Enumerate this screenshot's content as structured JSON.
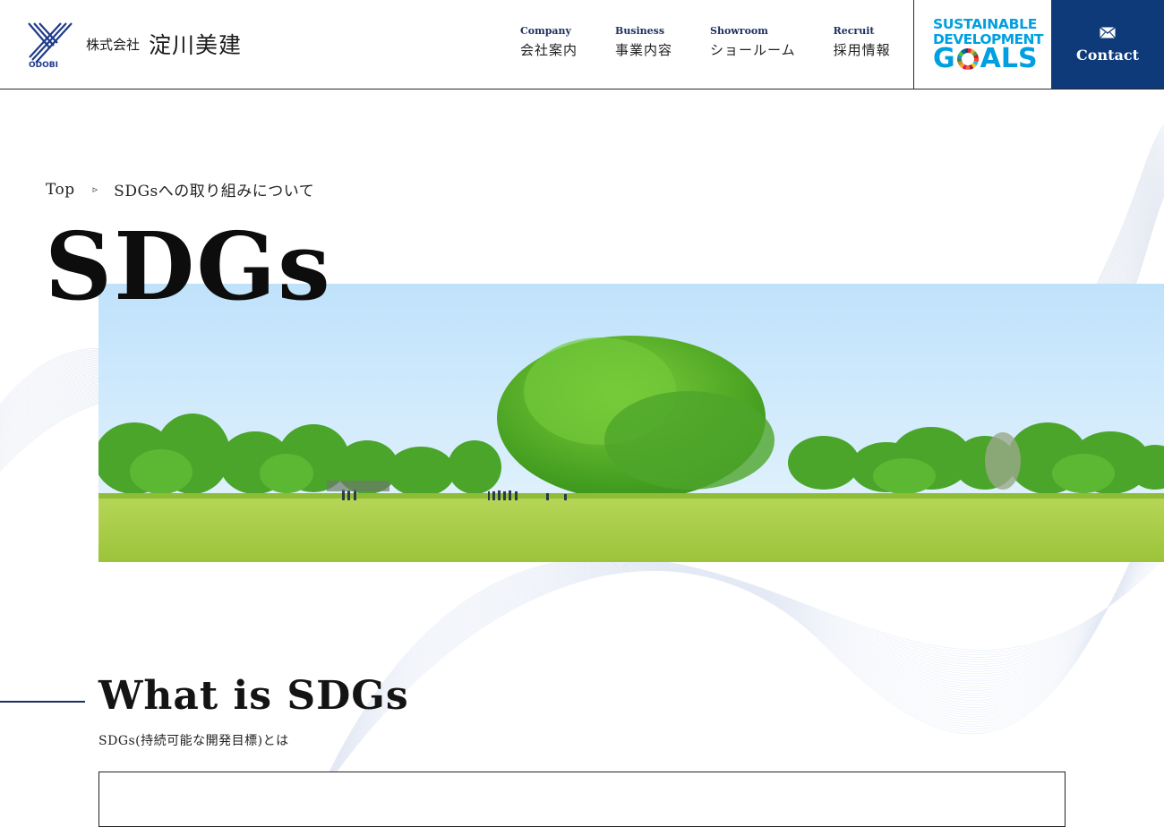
{
  "header": {
    "logo": {
      "tag": "ODOBI",
      "company": "株式会社",
      "name": "淀川美建"
    },
    "nav": [
      {
        "en": "Company",
        "ja": "会社案内"
      },
      {
        "en": "Business",
        "ja": "事業内容"
      },
      {
        "en": "Showroom",
        "ja": "ショールーム"
      },
      {
        "en": "Recruit",
        "ja": "採用情報"
      }
    ],
    "sdgs_badge": {
      "line1": "SUSTAINABLE",
      "line2": "DEVELOPMENT",
      "goals_g": "G",
      "goals_rest": "ALS"
    },
    "contact": {
      "label": "Contact",
      "icon": "mail-icon"
    }
  },
  "breadcrumb": {
    "top": "Top",
    "separator": "▹",
    "current": "SDGsへの取り組みについて"
  },
  "hero": {
    "title": "SDGs",
    "image": "park-tree-photo"
  },
  "section": {
    "title": "What is SDGs",
    "subtitle": "SDGs(持続可能な開発目標)とは"
  },
  "colors": {
    "navy": "#0e3a7a",
    "sdg_blue": "#00a0e0",
    "text": "#1a1a1a"
  }
}
